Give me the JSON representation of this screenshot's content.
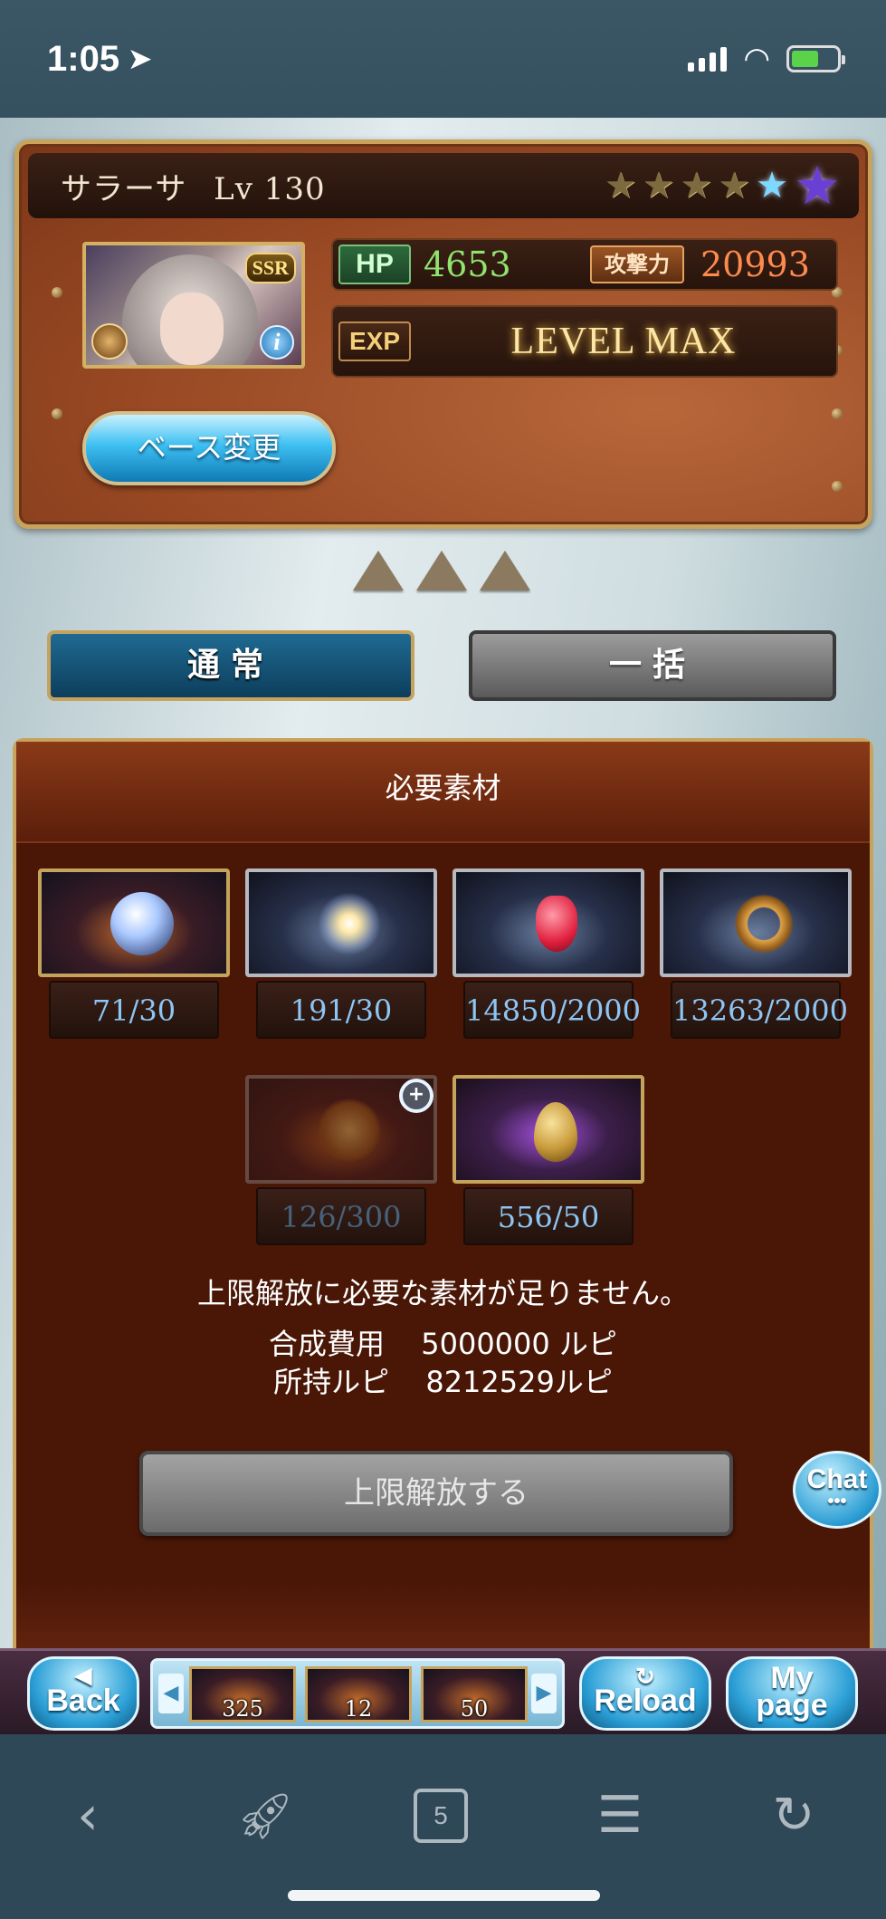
{
  "status_bar": {
    "time": "1:05",
    "battery_fill": 0.6
  },
  "character": {
    "name": "サラーサ",
    "level": "Lv 130",
    "rarity": "SSR",
    "hp_label": "HP",
    "hp": "4653",
    "atk_label": "攻撃力",
    "atk": "20993",
    "exp_label": "EXP",
    "exp_status": "LEVEL MAX",
    "stars_filled": 4,
    "stars_total": 6,
    "base_change_label": "ベース変更"
  },
  "tabs": {
    "normal": "通常",
    "bulk": "一括"
  },
  "materials": {
    "title": "必要素材",
    "items": [
      {
        "count": "71/30",
        "style": "blue"
      },
      {
        "count": "191/30",
        "style": "blue"
      },
      {
        "count": "14850/2000",
        "style": "blue"
      },
      {
        "count": "13263/2000",
        "style": "blue"
      },
      {
        "count": "126/300",
        "style": "dim"
      },
      {
        "count": "556/50",
        "style": "purple"
      }
    ],
    "message": "上限解放に必要な素材が足りません。",
    "cost_label": "合成費用",
    "cost_value": "5000000 ルピ",
    "owned_label": "所持ルピ",
    "owned_value": "8212529ルピ",
    "limit_break_button": "上限解放する"
  },
  "chat_label": "Chat",
  "game_bar": {
    "back": "Back",
    "reload": "Reload",
    "mypage_line1": "My",
    "mypage_line2": "page",
    "strip_items": [
      {
        "count": "325"
      },
      {
        "count": "12"
      },
      {
        "count": "50"
      }
    ]
  },
  "browser_bar": {
    "tab_count": "5"
  },
  "colors": {
    "accent_gold": "#c9a35b",
    "panel_brown": "#4a1707",
    "hp_green": "#8fe36e",
    "atk_orange": "#ff8a4d",
    "count_blue": "#8dc5f3"
  }
}
